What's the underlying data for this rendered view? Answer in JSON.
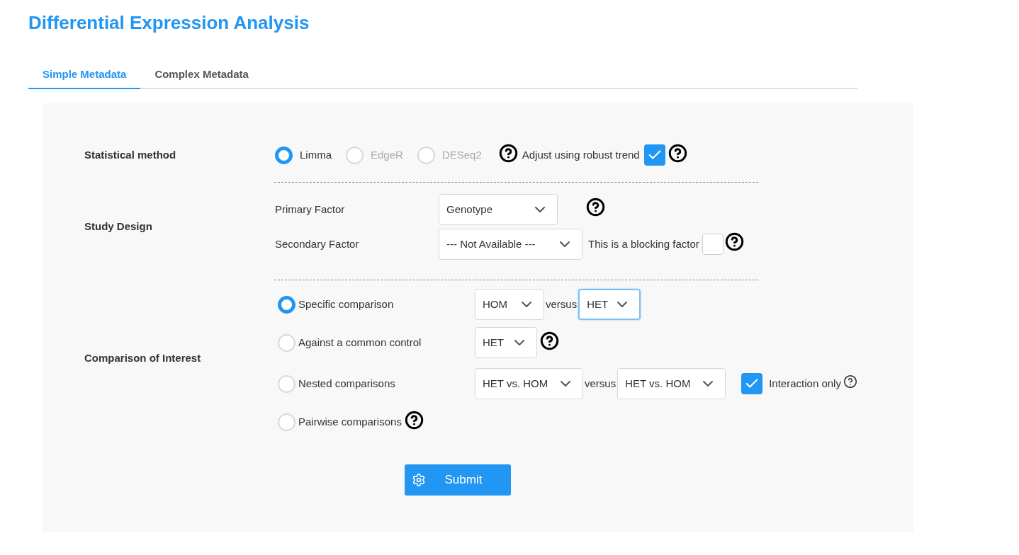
{
  "title": "Differential Expression Analysis",
  "tabs": [
    {
      "label": "Simple Metadata",
      "selected": true
    },
    {
      "label": "Complex Metadata",
      "selected": false
    }
  ],
  "statistical_method": {
    "label": "Statistical method",
    "options": [
      {
        "label": "Limma",
        "selected": true,
        "disabled": false
      },
      {
        "label": "EdgeR",
        "selected": false,
        "disabled": true
      },
      {
        "label": "DESeq2",
        "selected": false,
        "disabled": true
      }
    ],
    "robust_trend": {
      "label": "Adjust using robust trend",
      "checked": true
    }
  },
  "study_design": {
    "label": "Study Design",
    "primary": {
      "label": "Primary Factor",
      "value": "Genotype"
    },
    "secondary": {
      "label": "Secondary Factor",
      "value": "--- Not Available ---"
    },
    "blocking": {
      "label": "This is a blocking factor",
      "checked": false
    }
  },
  "comparison": {
    "label": "Comparison of Interest",
    "options": [
      {
        "kind": "pair",
        "label": "Specific comparison",
        "selected": true,
        "selects": [
          {
            "value": "HOM",
            "focused": false
          },
          {
            "value": "HET",
            "focused": true
          }
        ],
        "joiner": "versus"
      },
      {
        "kind": "single",
        "label": "Against a common control",
        "selected": false,
        "selects": [
          {
            "value": "HET",
            "focused": false
          }
        ]
      },
      {
        "kind": "nested",
        "label": "Nested comparisons",
        "selected": false,
        "selects": [
          {
            "value": "HET vs. HOM",
            "focused": false
          },
          {
            "value": "HET vs. HOM",
            "focused": false
          }
        ],
        "joiner": "versus",
        "interaction": {
          "label": "Interaction only",
          "checked": true
        }
      },
      {
        "kind": "plain",
        "label": "Pairwise comparisons",
        "selected": false
      }
    ]
  },
  "submit": "Submit"
}
